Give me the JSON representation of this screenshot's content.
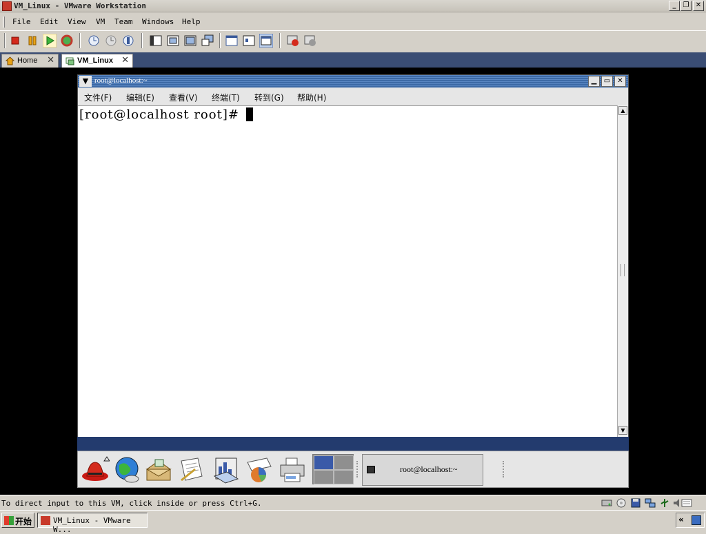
{
  "window": {
    "title": "VM_Linux - VMware Workstation",
    "controls": {
      "minimize": "_",
      "restore": "❐",
      "close": "✕"
    }
  },
  "menu": [
    "File",
    "Edit",
    "View",
    "VM",
    "Team",
    "Windows",
    "Help"
  ],
  "toolbar": {
    "icons": [
      "power-off-icon",
      "suspend-icon",
      "power-on-icon",
      "reset-icon",
      "snapshot-icon",
      "revert-snapshot-icon",
      "snapshot-manager-icon",
      "sidebar-view-icon",
      "fullscreen-icon",
      "quick-switch-icon",
      "console-view-icon",
      "summary-view-icon",
      "appliance-view-icon",
      "console-view-active-icon",
      "record-icon",
      "replay-icon"
    ]
  },
  "tabs": [
    {
      "label": "Home",
      "icon": "home-icon",
      "close": "✕",
      "active": false
    },
    {
      "label": "VM_Linux",
      "icon": "vm-icon",
      "close": "✕",
      "active": true
    }
  ],
  "terminal": {
    "title": "root@localhost:~",
    "menu": [
      "文件(F)",
      "编辑(E)",
      "查看(V)",
      "终端(T)",
      "转到(G)",
      "帮助(H)"
    ],
    "prompt": "[root@localhost root]#",
    "scroll_up": "▲",
    "scroll_down": "▼",
    "window_menu_glyph": "▼",
    "controls": {
      "minimize": "▁",
      "maximize": "▭",
      "close": "✕"
    }
  },
  "guest_panel": {
    "launchers": [
      "redhat-menu-icon",
      "web-browser-icon",
      "email-icon",
      "writer-icon",
      "presentation-icon",
      "spreadsheet-icon",
      "print-manager-icon"
    ],
    "task_label": "root@localhost:~"
  },
  "statusbar": {
    "text": "To direct input to this VM, click inside or press Ctrl+G.",
    "icons": [
      "hard-disk-icon",
      "cdrom-icon",
      "floppy-icon",
      "network-icon",
      "usb-icon",
      "sound-icon",
      "message-log-icon"
    ]
  },
  "taskbar": {
    "start_label": "开始",
    "item_label": "VM_Linux - VMware W...",
    "tray_chevron": "«"
  },
  "colors": {
    "vm_background": "#000000",
    "tab_strip": "#3a4d74",
    "guest_desktop": "#233b6e",
    "terminal_title": "#4a78b5"
  }
}
